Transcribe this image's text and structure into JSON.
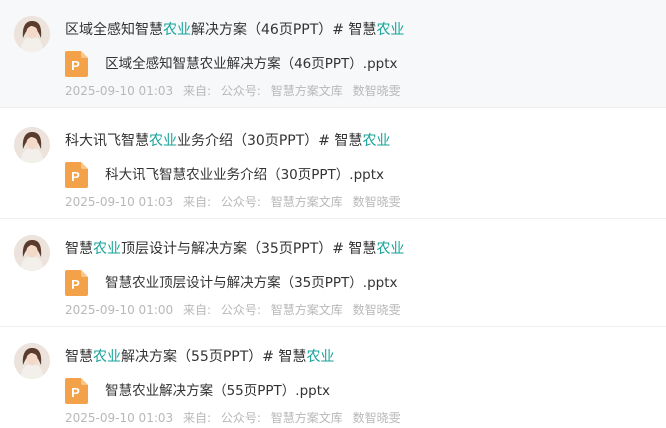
{
  "colors": {
    "keyword": "#16a398",
    "ppt_icon": "#f4a24a",
    "meta_text": "#b8b8b8"
  },
  "icons": {
    "avatar": "user-avatar",
    "file": "ppt-file-icon"
  },
  "items": [
    {
      "title": {
        "pre": "区域全感知智慧",
        "kw1": "农业",
        "mid": "解决方案（46页PPT）# 智慧",
        "kw2": "农业"
      },
      "file_name": "区域全感知智慧农业解决方案（46页PPT）.pptx",
      "date": "2025-09-10 01:03",
      "source_label": "来自:",
      "source": "公众号:",
      "account": "智慧方案文库",
      "tag": "数智晓雯"
    },
    {
      "title": {
        "pre": "科大讯飞智慧",
        "kw1": "农业",
        "mid": "业务介绍（30页PPT）# 智慧",
        "kw2": "农业"
      },
      "file_name": "科大讯飞智慧农业业务介绍（30页PPT）.pptx",
      "date": "2025-09-10 01:03",
      "source_label": "来自:",
      "source": "公众号:",
      "account": "智慧方案文库",
      "tag": "数智晓雯"
    },
    {
      "title": {
        "pre": "智慧",
        "kw1": "农业",
        "mid": "顶层设计与解决方案（35页PPT）# 智慧",
        "kw2": "农业"
      },
      "file_name": "智慧农业顶层设计与解决方案（35页PPT）.pptx",
      "date": "2025-09-10 01:00",
      "source_label": "来自:",
      "source": "公众号:",
      "account": "智慧方案文库",
      "tag": "数智晓雯"
    },
    {
      "title": {
        "pre": "智慧",
        "kw1": "农业",
        "mid": "解决方案（55页PPT）# 智慧",
        "kw2": "农业"
      },
      "file_name": "智慧农业解决方案（55页PPT）.pptx",
      "date": "2025-09-10 01:03",
      "source_label": "来自:",
      "source": "公众号:",
      "account": "智慧方案文库",
      "tag": "数智晓雯"
    }
  ]
}
